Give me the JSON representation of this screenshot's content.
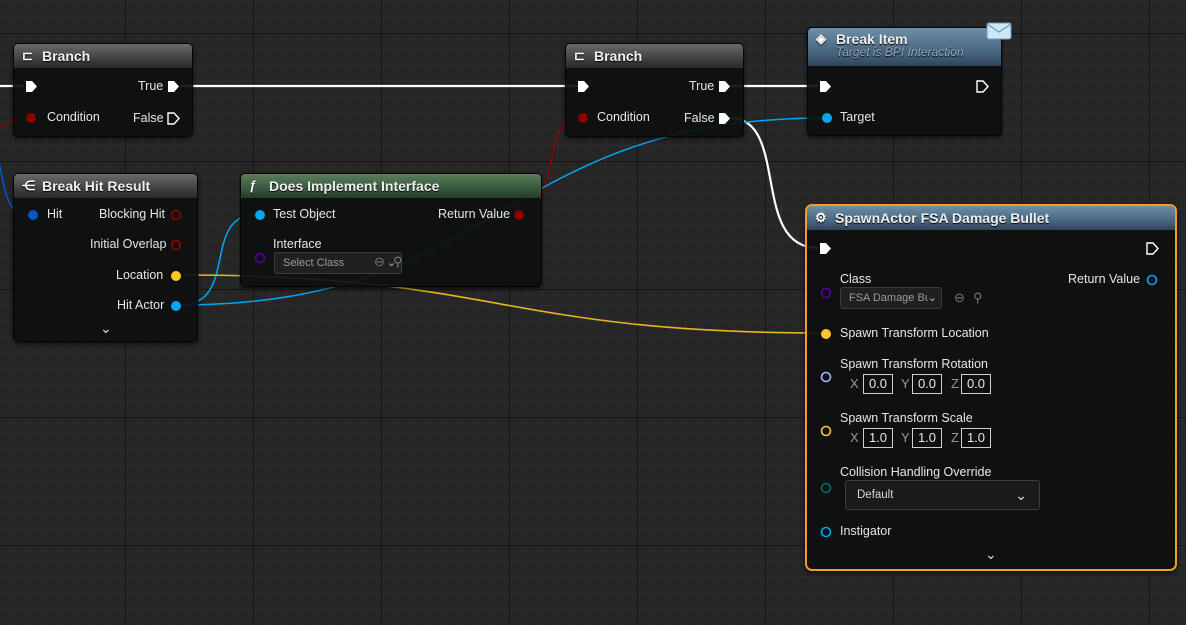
{
  "nodes": {
    "branch1": {
      "title": "Branch",
      "true_label": "True",
      "false_label": "False",
      "condition_label": "Condition"
    },
    "branch2": {
      "title": "Branch",
      "true_label": "True",
      "false_label": "False",
      "condition_label": "Condition"
    },
    "break_hit": {
      "title": "Break Hit Result",
      "hit_label": "Hit",
      "blocking_hit": "Blocking Hit",
      "initial_overlap": "Initial Overlap",
      "location": "Location",
      "hit_actor": "Hit Actor"
    },
    "implements": {
      "title": "Does Implement Interface",
      "test_object": "Test Object",
      "return_value": "Return Value",
      "interface_label": "Interface",
      "interface_value": "Select Class"
    },
    "break_item": {
      "title": "Break Item",
      "subtitle": "Target is BPI Interaction",
      "target_label": "Target"
    },
    "spawn": {
      "title": "SpawnActor FSA Damage Bullet",
      "class_label": "Class",
      "class_value": "FSA Damage Bu",
      "return_value": "Return Value",
      "location_label": "Spawn Transform Location",
      "rotation_label": "Spawn Transform Rotation",
      "rotation": {
        "x": "0.0",
        "y": "0.0",
        "z": "0.0"
      },
      "scale_label": "Spawn Transform Scale",
      "scale": {
        "x": "1.0",
        "y": "1.0",
        "z": "1.0"
      },
      "axis": {
        "x": "X",
        "y": "Y",
        "z": "Z"
      },
      "collision_label": "Collision Handling Override",
      "collision_value": "Default",
      "instigator_label": "Instigator"
    }
  },
  "colors": {
    "exec": "#ffffff",
    "bool": "#8c0000",
    "struct_hit": "#0058c8",
    "object": "#00a8f0",
    "vector": "#fdc828",
    "class": "#5a00a0",
    "rotator": "#a0b4ff",
    "enum": "#006e6e",
    "selected_outline": "#f0a020"
  }
}
